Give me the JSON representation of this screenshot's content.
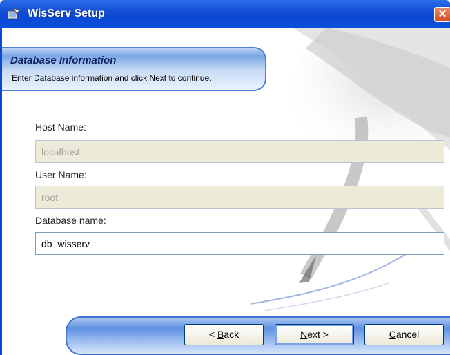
{
  "window": {
    "title": "WisServ Setup",
    "close_glyph": "✕"
  },
  "header": {
    "title": "Database Information",
    "subtitle": "Enter Database information and click Next to continue."
  },
  "form": {
    "host": {
      "label": "Host Name:",
      "value": "localhost"
    },
    "user": {
      "label": "User Name:",
      "value": "root"
    },
    "database": {
      "label": "Database name:",
      "value": "db_wisserv"
    }
  },
  "buttons": {
    "back": {
      "prefix": "< ",
      "mnemonic": "B",
      "rest": "ack"
    },
    "next": {
      "mnemonic": "N",
      "rest": "ext >"
    },
    "cancel": {
      "mnemonic": "C",
      "rest": "ancel"
    }
  },
  "icons": {
    "app": "installer-icon",
    "close": "close-icon"
  },
  "colors": {
    "titlebar": "#0a48d2",
    "banner_border": "#4c80d8",
    "disabled_field": "#ecead8"
  }
}
